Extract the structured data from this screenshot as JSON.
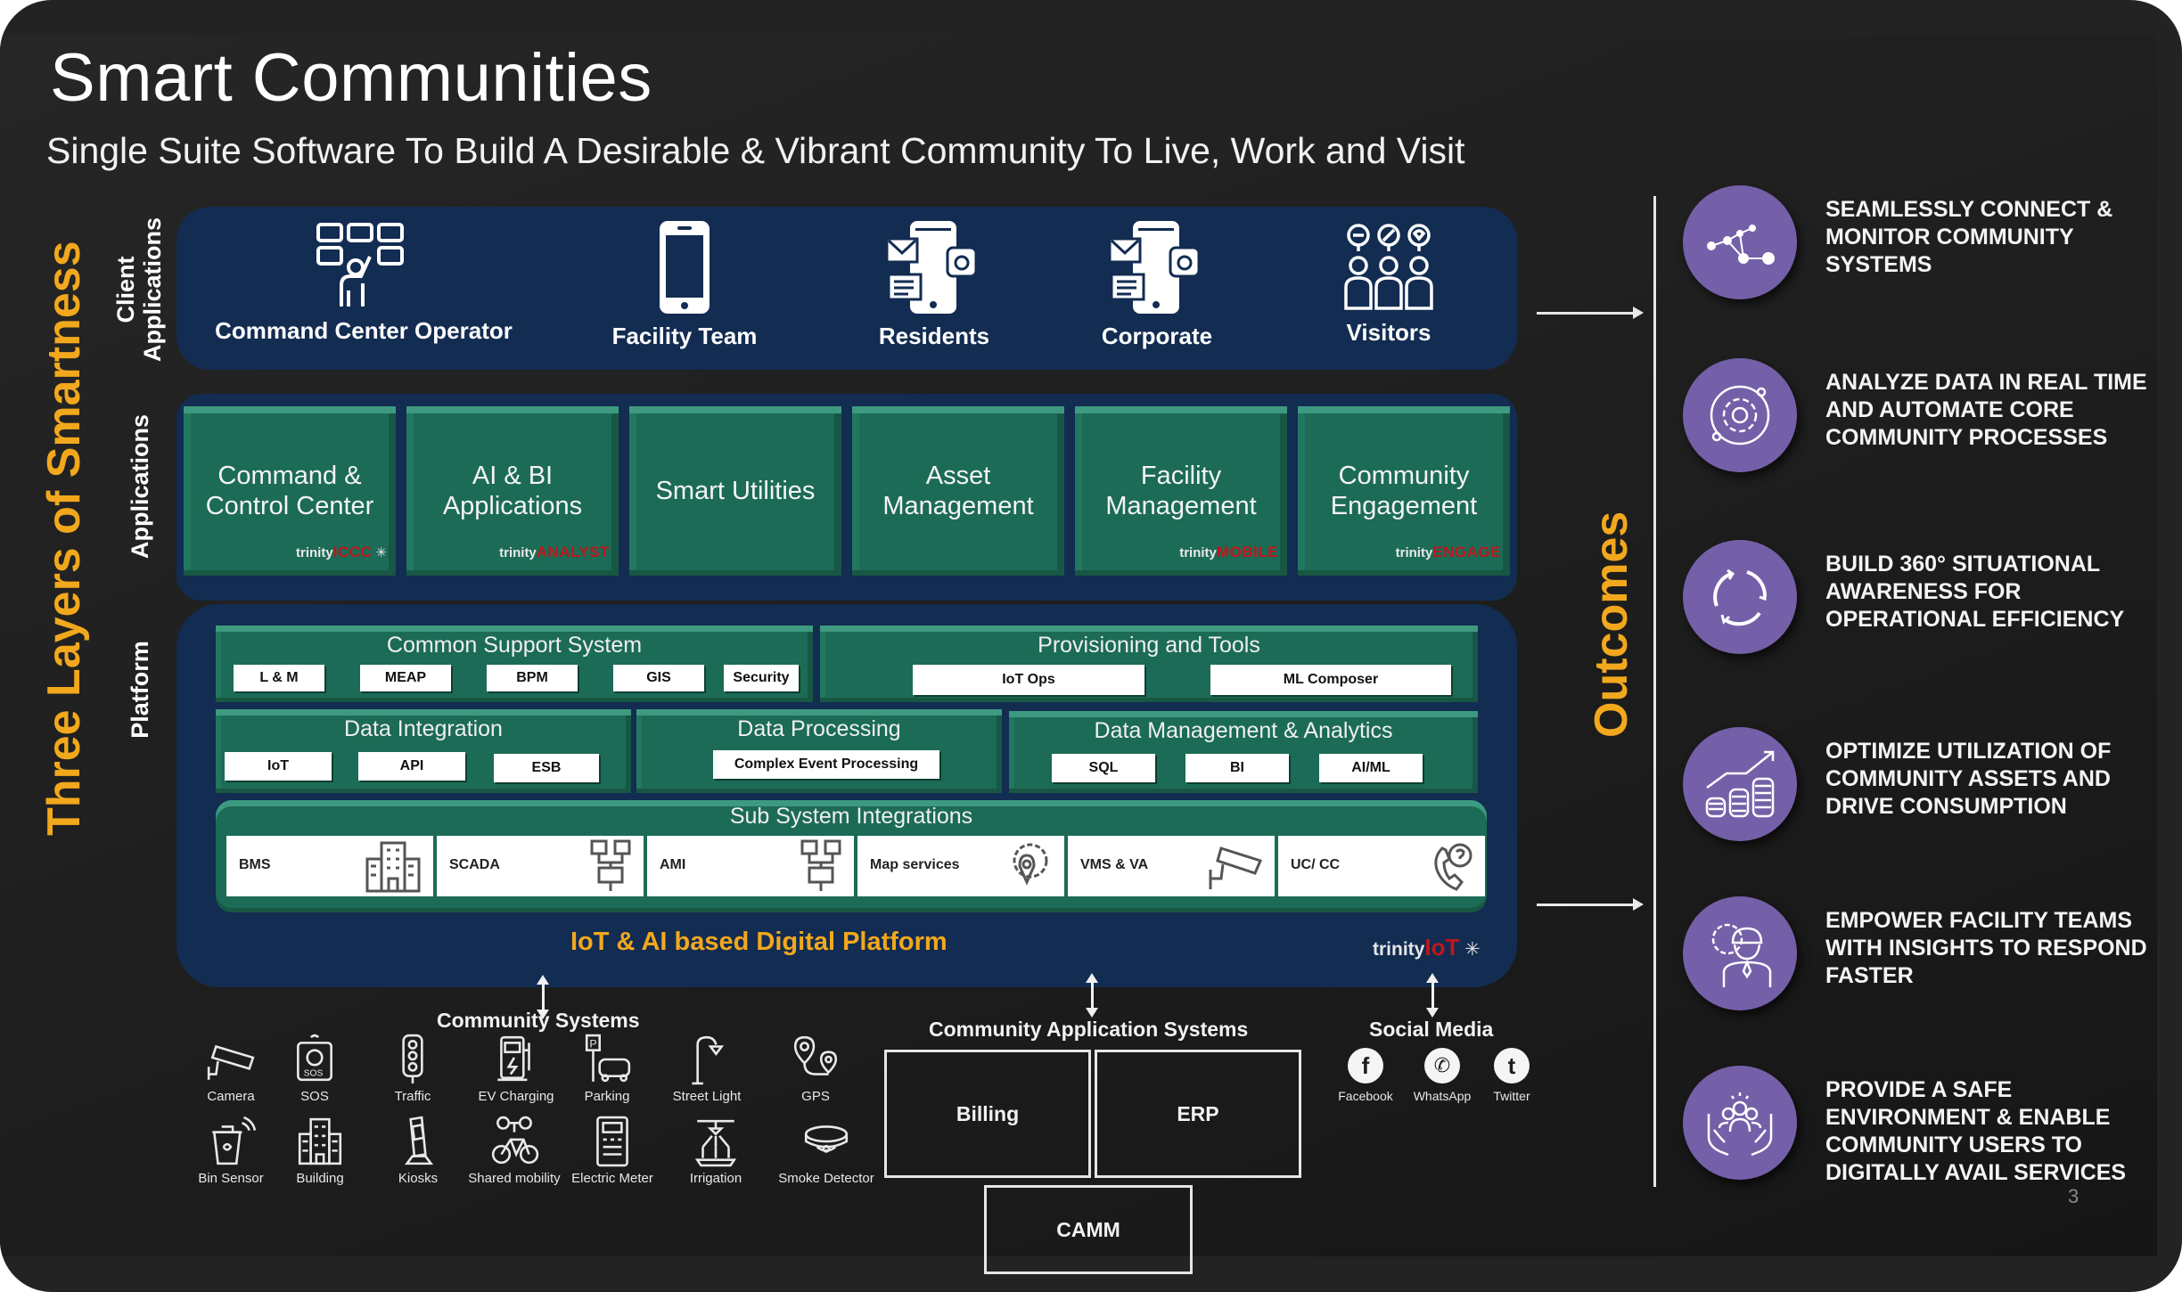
{
  "header": {
    "title": "Smart Communities",
    "subtitle": "Single Suite Software To Build A Desirable & Vibrant Community To Live, Work and Visit"
  },
  "side_labels": {
    "main": "Three Layers of Smartness",
    "client_line1": "Client",
    "client_line2": "Applications",
    "applications": "Applications",
    "platform": "Platform"
  },
  "client_applications": [
    {
      "label": "Command Center Operator",
      "icon": "operator-dashboard-icon"
    },
    {
      "label": "Facility Team",
      "icon": "smartphone-icon"
    },
    {
      "label": "Residents",
      "icon": "mobile-messaging-icon"
    },
    {
      "label": "Corporate",
      "icon": "mobile-messaging-icon"
    },
    {
      "label": "Visitors",
      "icon": "visitors-group-icon"
    }
  ],
  "applications": [
    {
      "line1": "Command &",
      "line2": "Control Center",
      "logo_prefix": "trinity",
      "logo_brand": "ICCC"
    },
    {
      "line1": "AI & BI",
      "line2": "Applications",
      "logo_prefix": "trinity",
      "logo_brand": "ANALYST"
    },
    {
      "line1": "Smart Utilities",
      "line2": "",
      "logo_prefix": "",
      "logo_brand": ""
    },
    {
      "line1": "Asset",
      "line2": "Management",
      "logo_prefix": "",
      "logo_brand": ""
    },
    {
      "line1": "Facility",
      "line2": "Management",
      "logo_prefix": "trinity",
      "logo_brand": "MOBILE"
    },
    {
      "line1": "Community",
      "line2": "Engagement",
      "logo_prefix": "trinity",
      "logo_brand": "ENGAGE"
    }
  ],
  "platform": {
    "common_support": {
      "title": "Common Support System",
      "items": [
        "L & M",
        "MEAP",
        "BPM",
        "GIS",
        "Security"
      ]
    },
    "provisioning": {
      "title": "Provisioning and Tools",
      "items": [
        "IoT Ops",
        "ML Composer"
      ]
    },
    "data_integration": {
      "title": "Data Integration",
      "items": [
        "IoT",
        "API",
        "ESB"
      ]
    },
    "data_processing": {
      "title": "Data Processing",
      "items": [
        "Complex Event Processing"
      ]
    },
    "data_management": {
      "title": "Data Management & Analytics",
      "items": [
        "SQL",
        "BI",
        "AI/ML"
      ]
    },
    "sub_systems": {
      "title": "Sub System Integrations",
      "items": [
        {
          "label": "BMS",
          "icon": "building-icon"
        },
        {
          "label": "SCADA",
          "icon": "network-nodes-icon"
        },
        {
          "label": "AMI",
          "icon": "network-nodes-icon"
        },
        {
          "label": "Map services",
          "icon": "map-gear-icon"
        },
        {
          "label": "VMS & VA",
          "icon": "cctv-camera-icon"
        },
        {
          "label": "UC/ CC",
          "icon": "phone-icon"
        }
      ]
    },
    "label": "IoT & AI based Digital Platform",
    "logo_prefix": "trinity",
    "logo_brand": "IoT"
  },
  "community_systems": {
    "title": "Community  Systems",
    "items": [
      {
        "label": "Camera",
        "icon": "camera-icon"
      },
      {
        "label": "SOS",
        "icon": "sos-icon"
      },
      {
        "label": "Traffic",
        "icon": "traffic-light-icon"
      },
      {
        "label": "EV Charging",
        "icon": "ev-charger-icon"
      },
      {
        "label": "Parking",
        "icon": "parking-icon"
      },
      {
        "label": "Street Light",
        "icon": "street-light-icon"
      },
      {
        "label": "GPS",
        "icon": "gps-icon"
      },
      {
        "label": "Bin Sensor",
        "icon": "bin-sensor-icon"
      },
      {
        "label": "Building",
        "icon": "building-icon"
      },
      {
        "label": "Kiosks",
        "icon": "kiosk-icon"
      },
      {
        "label": "Shared mobility",
        "icon": "bicycle-icon"
      },
      {
        "label": "Electric Meter",
        "icon": "electric-meter-icon"
      },
      {
        "label": "Irrigation",
        "icon": "irrigation-icon"
      },
      {
        "label": "Smoke Detector",
        "icon": "smoke-detector-icon"
      }
    ]
  },
  "community_app_systems": {
    "title": "Community Application Systems",
    "items": [
      "Billing",
      "ERP",
      "CAMM"
    ]
  },
  "social_media": {
    "title": "Social Media",
    "items": [
      {
        "label": "Facebook",
        "glyph": "f"
      },
      {
        "label": "WhatsApp",
        "glyph": "✆"
      },
      {
        "label": "Twitter",
        "glyph": "t"
      }
    ]
  },
  "outcomes": {
    "label": "Outcomes",
    "items": [
      {
        "text": "SEAMLESSLY CONNECT & MONITOR COMMUNITY SYSTEMS",
        "icon": "network-graph-icon"
      },
      {
        "text": "ANALYZE DATA IN REAL TIME AND AUTOMATE CORE COMMUNITY PROCESSES",
        "icon": "gear-cycle-icon"
      },
      {
        "text": "BUILD  360° SITUATIONAL AWARENESS FOR OPERATIONAL EFFICIENCY",
        "icon": "refresh-cycle-icon"
      },
      {
        "text": "OPTIMIZE UTILIZATION OF COMMUNITY ASSETS AND DRIVE CONSUMPTION",
        "icon": "growth-coins-icon"
      },
      {
        "text": "EMPOWER  FACILITY TEAMS WITH INSIGHTS TO RESPOND FASTER",
        "icon": "engineer-icon"
      },
      {
        "text": "PROVIDE A SAFE ENVIRONMENT & ENABLE COMMUNITY USERS TO DIGITALLY  AVAIL SERVICES",
        "icon": "community-hands-icon"
      }
    ]
  },
  "page_number": "3",
  "colors": {
    "accent_orange": "#f2a81d",
    "navy_panel": "#122c52",
    "green_tile": "#1c6b56",
    "outcome_purple": "#7460a8",
    "brand_red": "#c0161b"
  }
}
